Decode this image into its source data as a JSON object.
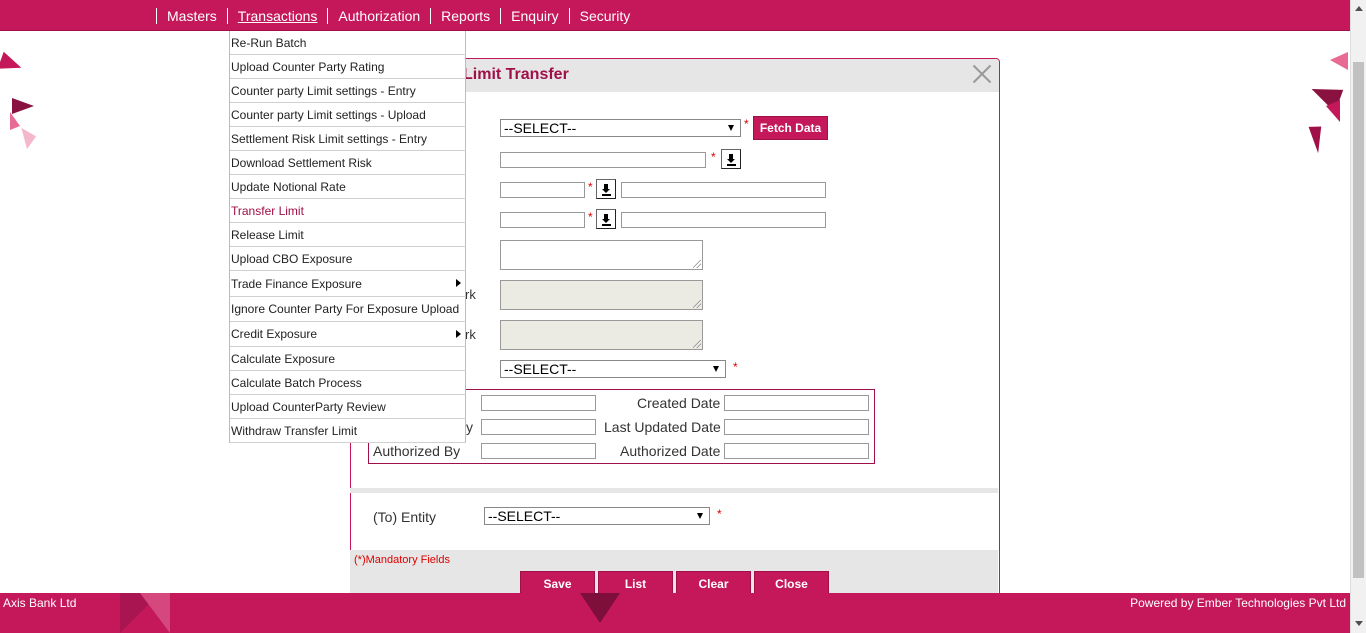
{
  "nav": {
    "items": [
      {
        "label": "Masters",
        "active": false
      },
      {
        "label": "Transactions",
        "active": true
      },
      {
        "label": "Authorization",
        "active": false
      },
      {
        "label": "Reports",
        "active": false
      },
      {
        "label": "Enquiry",
        "active": false
      },
      {
        "label": "Security",
        "active": false
      }
    ]
  },
  "menu": {
    "items": [
      {
        "label": "Re-Run Batch",
        "submenu": false,
        "active": false
      },
      {
        "label": "Upload Counter Party Rating",
        "submenu": false,
        "active": false
      },
      {
        "label": "Counter party Limit settings - Entry",
        "submenu": false,
        "active": false
      },
      {
        "label": "Counter party Limit settings - Upload",
        "submenu": false,
        "active": false
      },
      {
        "label": "Settlement Risk Limit settings - Entry",
        "submenu": false,
        "active": false
      },
      {
        "label": "Download Settlement Risk",
        "submenu": false,
        "active": false
      },
      {
        "label": "Update Notional Rate",
        "submenu": false,
        "active": false
      },
      {
        "label": "Transfer Limit",
        "submenu": false,
        "active": true
      },
      {
        "label": "Release Limit",
        "submenu": false,
        "active": false
      },
      {
        "label": "Upload CBO Exposure",
        "submenu": false,
        "active": false
      },
      {
        "label": "Trade Finance Exposure",
        "submenu": true,
        "active": false
      },
      {
        "label": "Ignore Counter Party For Exposure Upload",
        "submenu": false,
        "active": false
      },
      {
        "label": "Credit Exposure",
        "submenu": true,
        "active": false
      },
      {
        "label": "Calculate Exposure",
        "submenu": false,
        "active": false
      },
      {
        "label": "Calculate Batch Process",
        "submenu": false,
        "active": false
      },
      {
        "label": "Upload CounterParty Review",
        "submenu": false,
        "active": false
      },
      {
        "label": "Withdraw Transfer Limit",
        "submenu": false,
        "active": false
      }
    ]
  },
  "dialog": {
    "title": "Limit Transfer",
    "select1_value": "--SELECT--",
    "fetch_label": "Fetch Data",
    "partial_label_1": "rk",
    "partial_label_2": "rk",
    "select2_value": "--SELECT--",
    "required_mark": "*"
  },
  "audit": {
    "created_date_label": "Created Date",
    "last_updated_by_partial": "y",
    "last_updated_date_label": "Last Updated Date",
    "authorized_by_label": "Authorized By",
    "authorized_date_label": "Authorized Date"
  },
  "to_entity": {
    "label": "(To) Entity",
    "value": "--SELECT--"
  },
  "footer_form": {
    "mandatory_note": "(*)Mandatory Fields",
    "save_label": "Save",
    "list_label": "List",
    "clear_label": "Clear",
    "close_label": "Close"
  },
  "bottom": {
    "left": "Axis Bank Ltd",
    "right": "Powered by Ember Technologies Pvt Ltd"
  },
  "colors": {
    "brand": "#c4185a",
    "brand_dark": "#a01048",
    "required": "#dd0000"
  }
}
